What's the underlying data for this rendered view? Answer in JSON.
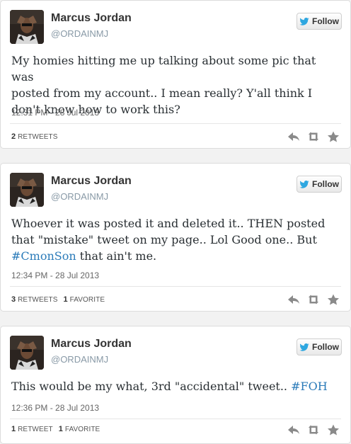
{
  "colors": {
    "hashtag": "#2b7bb9",
    "meta": "#8899a6",
    "icon": "#8a8a8a",
    "bird": "#2ea7e0"
  },
  "follow_label": "Follow",
  "tweets": [
    {
      "name": "Marcus Jordan",
      "handle": "@ORDAINMJ",
      "text_lines": [
        "My homies hitting me up talking about some pic that was",
        "posted from my account.. I mean really? Y'all think I",
        "don't know how to work this?"
      ],
      "time": "12:31 PM - 28 Jul 2013",
      "retweets_count": "2",
      "retweets_label": "RETWEETS",
      "favorites_count": "",
      "favorites_label": ""
    },
    {
      "name": "Marcus Jordan",
      "handle": "@ORDAINMJ",
      "text_lines": [
        "Whoever it was posted it and deleted it.. THEN posted",
        "that \"mistake\" tweet on my page.. Lol Good one.. But"
      ],
      "hashtag": "#CmonSon",
      "text_after_hashtag": " that ain't me.",
      "time": "12:34 PM - 28 Jul 2013",
      "retweets_count": "3",
      "retweets_label": "RETWEETS",
      "favorites_count": "1",
      "favorites_label": "FAVORITE"
    },
    {
      "name": "Marcus Jordan",
      "handle": "@ORDAINMJ",
      "text_before_hashtag": "This would be my what, 3rd \"accidental\" tweet.. ",
      "hashtag": "#FOH",
      "time": "12:36 PM - 28 Jul 2013",
      "retweets_count": "1",
      "retweets_label": "RETWEET",
      "favorites_count": "1",
      "favorites_label": "FAVORITE"
    }
  ],
  "icons": {
    "reply": "reply-icon",
    "retweet": "retweet-icon",
    "favorite": "star-icon",
    "follow": "twitter-bird-icon"
  }
}
